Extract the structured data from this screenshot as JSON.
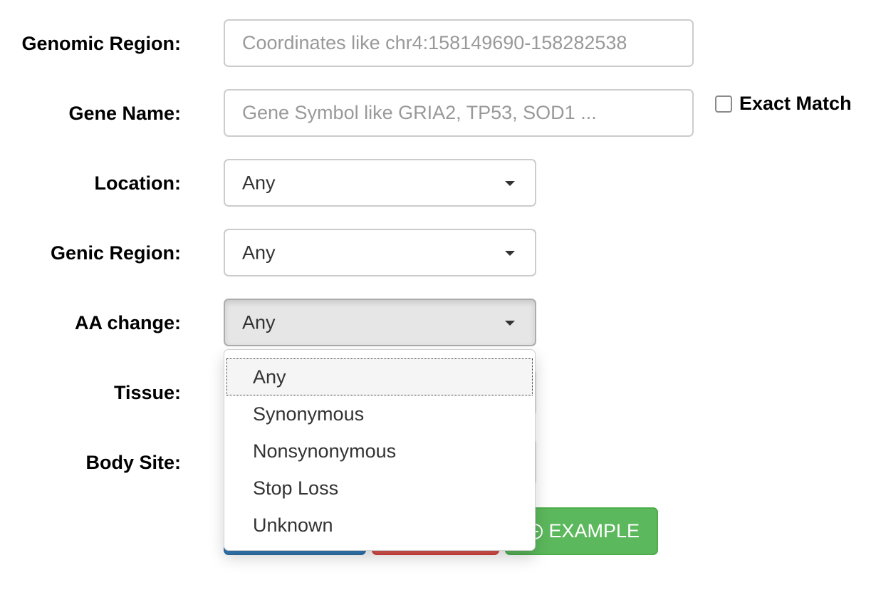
{
  "form": {
    "genomic_region": {
      "label": "Genomic Region:",
      "placeholder": "Coordinates like chr4:158149690-158282538"
    },
    "gene_name": {
      "label": "Gene Name:",
      "placeholder": "Gene Symbol like GRIA2, TP53, SOD1 ...",
      "exact_match_label": "Exact Match"
    },
    "location": {
      "label": "Location:",
      "value": "Any"
    },
    "genic_region": {
      "label": "Genic Region:",
      "value": "Any"
    },
    "aa_change": {
      "label": "AA change:",
      "value": "Any",
      "options": [
        "Any",
        "Synonymous",
        "Nonsynonymous",
        "Stop Loss",
        "Unknown"
      ]
    },
    "tissue": {
      "label": "Tissue:"
    },
    "body_site": {
      "label": "Body Site:"
    }
  },
  "buttons": {
    "example_label": "EXAMPLE"
  },
  "colors": {
    "primary": "#337ab7",
    "danger": "#d9534f",
    "success": "#5cb85c"
  }
}
